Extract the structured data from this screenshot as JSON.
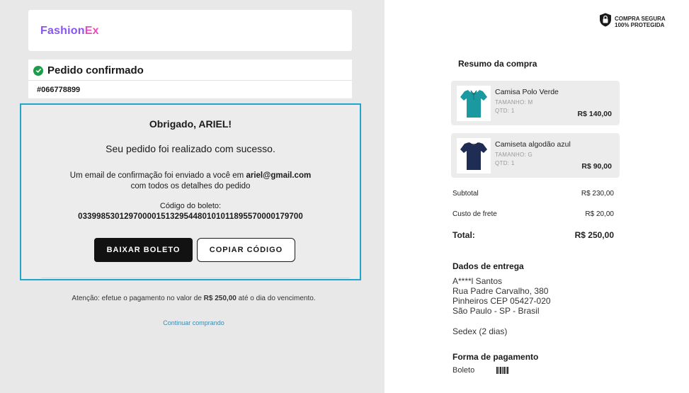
{
  "brand": {
    "part1": "Fashion",
    "part2": "Ex",
    "color1": "#8a56f0",
    "color2": "#e84bc1"
  },
  "order": {
    "status_title": "Pedido confirmado",
    "number": "#066778899",
    "status_color": "#1e9c4a"
  },
  "confirmation": {
    "title": "Obrigado, ARIEL!",
    "subtitle": "Seu pedido foi realizado com sucesso.",
    "email_prefix": "Um email de confirmação foi enviado a você em",
    "email": "ariel@gmail.com",
    "email_suffix": "com todos os detalhes do pedido",
    "boleto_label": "Código do boleto:",
    "boleto_code": "03399853012970000151329544801010118955700001797 00",
    "download_button": "BAIXAR BOLETO",
    "copy_button": "COPIAR CÓDIGO",
    "highlight_color": "#1fa6cf"
  },
  "attention": {
    "prefix": "Atenção: efetue o pagamento no valor de",
    "amount": "R$ 250,00",
    "suffix": "até o dia do vencimento."
  },
  "continue_link": "Continuar comprando",
  "secure_badge": {
    "line1": "COMPRA SEGURA",
    "line2": "100% PROTEGIDA",
    "icon": "lock-shield-icon"
  },
  "summary": {
    "title": "Resumo da compra",
    "items": [
      {
        "name": "Camisa Polo Verde",
        "size": "TAMANHO: M",
        "qty": "QTD: 1",
        "price": "R$ 140,00",
        "color": "#1a9aa0"
      },
      {
        "name": "Camiseta algodão azul",
        "size": "TAMANHO: G",
        "qty": "QTD: 1",
        "price": "R$ 90,00",
        "color": "#1f2d55"
      }
    ],
    "subtotal_label": "Subtotal",
    "subtotal_value": "R$ 230,00",
    "shipping_label": "Custo de frete",
    "shipping_value": "R$ 20,00",
    "total_label": "Total:",
    "total_value": "R$ 250,00"
  },
  "delivery": {
    "title": "Dados de entrega",
    "lines": [
      "A****l Santos",
      "Rua Padre Carvalho, 380",
      "Pinheiros CEP 05427-020",
      "São Paulo - SP - Brasil"
    ],
    "method": "Sedex (2 dias)"
  },
  "payment": {
    "title": "Forma de pagamento",
    "method": "Boleto",
    "icon": "barcode-icon"
  }
}
